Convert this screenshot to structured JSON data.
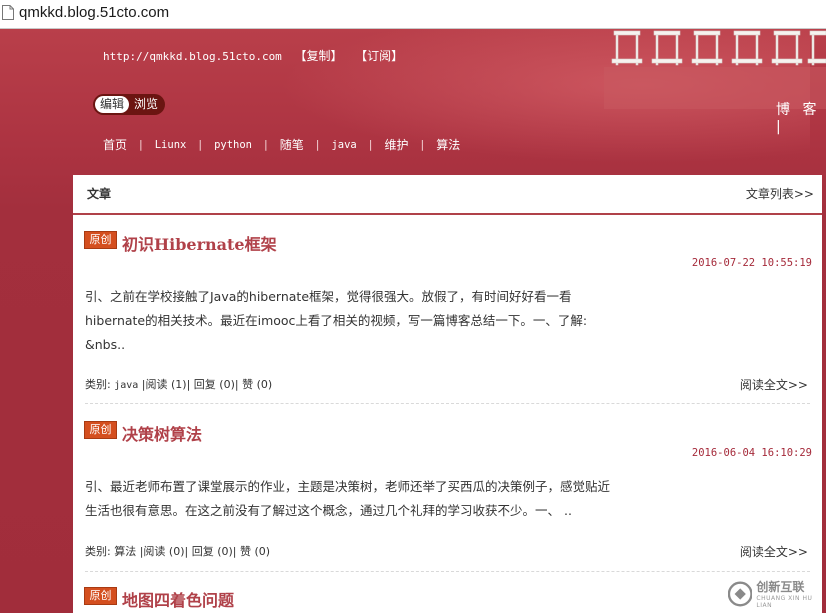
{
  "browser": {
    "url": "qmkkd.blog.51cto.com"
  },
  "header": {
    "blog_url": "http://qmkkd.blog.51cto.com",
    "copy_link": "【复制】",
    "subscribe_link": "【订阅】",
    "toggle": {
      "edit": "编辑",
      "browse": "浏览"
    },
    "blog_label": "博 客 |"
  },
  "nav": {
    "items": [
      {
        "label": "首页"
      },
      {
        "label": "Liunx"
      },
      {
        "label": "python"
      },
      {
        "label": "随笔"
      },
      {
        "label": "java"
      },
      {
        "label": "维护"
      },
      {
        "label": "算法"
      }
    ],
    "separator": "|"
  },
  "panel": {
    "title": "文章",
    "list_link": "文章列表>>"
  },
  "articles": [
    {
      "tag": "原创",
      "title": "初识Hibernate框架",
      "date": "2016-07-22 10:55:19",
      "summary": [
        "引、之前在学校接触了Java的hibernate框架，觉得很强大。放假了，有时间好好看一看",
        "hibernate的相关技术。最近在imooc上看了相关的视频，写一篇博客总结一下。一、了解:",
        "&nbs.."
      ],
      "meta": {
        "category_label": "类别:",
        "category": "java",
        "reads": "阅读 (1)",
        "replies": "回复 (0)",
        "likes": "赞 (0)"
      },
      "read_more": "阅读全文>>"
    },
    {
      "tag": "原创",
      "title": "决策树算法",
      "date": "2016-06-04 16:10:29",
      "summary": [
        "引、最近老师布置了课堂展示的作业，主题是决策树，老师还举了买西瓜的决策例子，感觉贴近",
        "生活也很有意思。在这之前没有了解过这个概念，通过几个礼拜的学习收获不少。一、 .."
      ],
      "meta": {
        "category_label": "类别:",
        "category": "算法",
        "reads": "阅读 (0)",
        "replies": "回复 (0)",
        "likes": "赞 (0)"
      },
      "read_more": "阅读全文>>"
    },
    {
      "tag": "原创",
      "title": "地图四着色问题"
    }
  ],
  "watermark": {
    "name": "创新互联",
    "sub": "CHUANG XIN HU LIAN"
  },
  "colors": {
    "banner": "#a52f3d",
    "accent": "#b04149",
    "tag": "#d44f1f",
    "date": "#a52a3a"
  },
  "icons": {
    "page": "page-icon",
    "chairs": "chairs-decoration",
    "logo": "watermark-logo-icon"
  }
}
